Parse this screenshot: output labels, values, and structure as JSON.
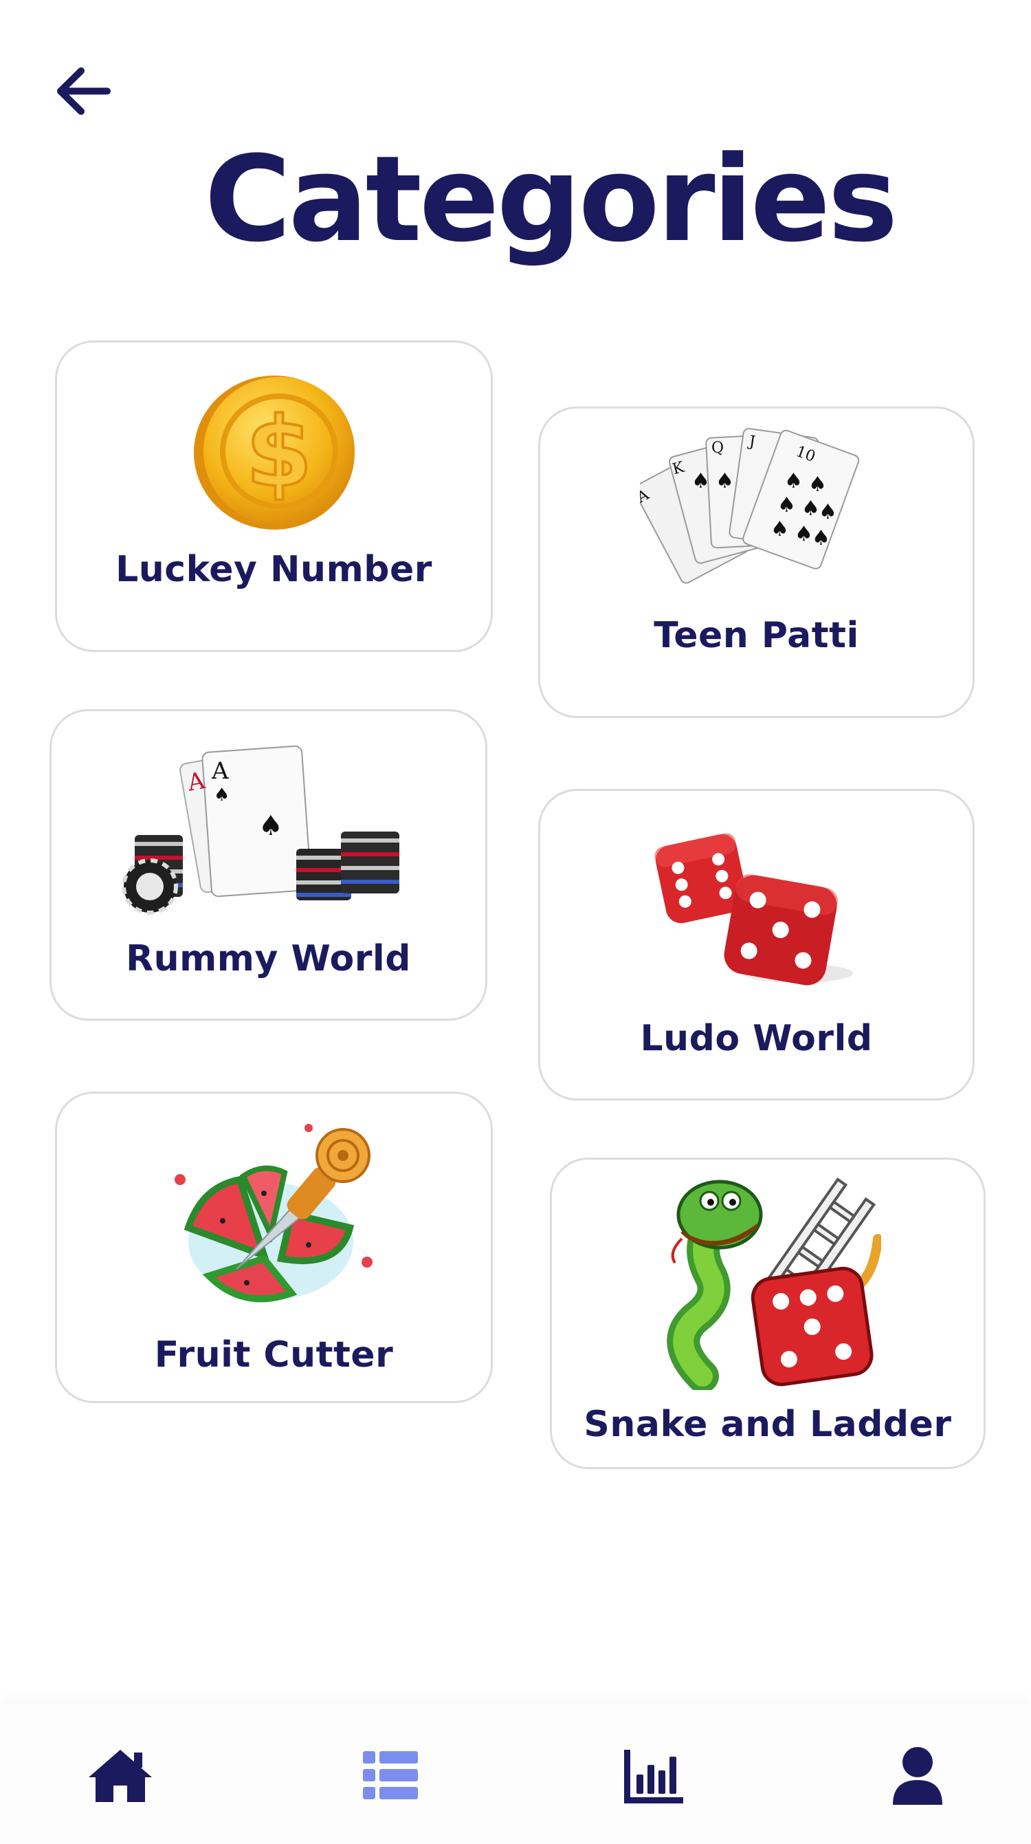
{
  "header": {
    "title": "Categories"
  },
  "categories": [
    {
      "label": "Luckey Number",
      "icon": "gold-coin-icon"
    },
    {
      "label": "Teen Patti",
      "icon": "playing-cards-icon"
    },
    {
      "label": "Rummy World",
      "icon": "cards-and-chips-icon"
    },
    {
      "label": "Ludo World",
      "icon": "dice-icon"
    },
    {
      "label": "Fruit Cutter",
      "icon": "watermelon-knife-icon"
    },
    {
      "label": "Snake and Ladder",
      "icon": "snake-ladder-dice-icon"
    }
  ],
  "bottom_nav": [
    {
      "icon": "home-icon",
      "active": false
    },
    {
      "icon": "list-icon",
      "active": true
    },
    {
      "icon": "bar-chart-icon",
      "active": false
    },
    {
      "icon": "user-icon",
      "active": false
    }
  ],
  "colors": {
    "primary": "#1c1a5e",
    "active_nav": "#7b8ef0",
    "card_border": "#dcdcdc",
    "dice_red": "#d9262b",
    "coin_gold": "#f5b517"
  }
}
